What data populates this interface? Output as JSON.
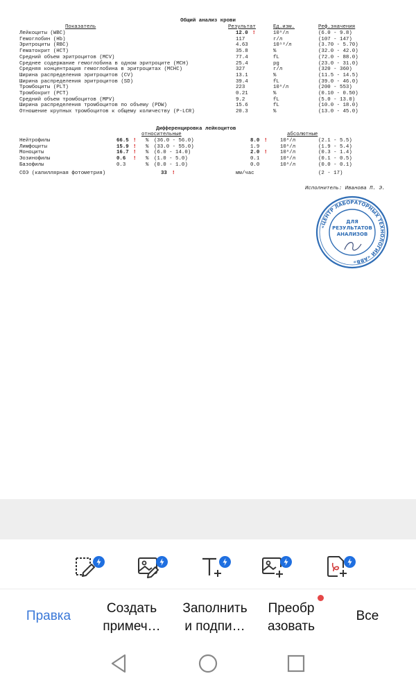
{
  "document": {
    "title": "Общий анализ крови",
    "headers": {
      "indicator": "Показатель",
      "result": "Результат",
      "unit": "Ед.изм.",
      "ref": "Реф.значения"
    },
    "rows": [
      {
        "name": "Лейкоциты (WBC)",
        "value": "12.0",
        "flag": "!",
        "unit": "10⁹/л",
        "ref": "(6.0 - 9.8)"
      },
      {
        "name": "Гемоглобин (Hb)",
        "value": "117",
        "flag": "",
        "unit": "г/л",
        "ref": "(107 - 147)"
      },
      {
        "name": "Эритроциты (RBC)",
        "value": "4.63",
        "flag": "",
        "unit": "10¹²/л",
        "ref": "(3.70 - 5.70)"
      },
      {
        "name": "Гематокрит (HCT)",
        "value": "35.8",
        "flag": "",
        "unit": "%",
        "ref": "(32.0 - 42.0)"
      },
      {
        "name": "Средний объем эритроцитов (MCV)",
        "value": "77.4",
        "flag": "",
        "unit": "fL",
        "ref": "(72.0 - 88.0)"
      },
      {
        "name": "Среднее содержание гемоглобина в одном эритроците (MCH)",
        "value": "25.4",
        "flag": "",
        "unit": "pg",
        "ref": "(23.0 - 31.0)"
      },
      {
        "name": "Средняя концентрация гемоглобина в эритроцитах (MCHC)",
        "value": "327",
        "flag": "",
        "unit": "г/л",
        "ref": "(320 - 360)"
      },
      {
        "name": "Ширина распределения эритроцитов (CV)",
        "value": "13.1",
        "flag": "",
        "unit": "%",
        "ref": "(11.5 - 14.5)"
      },
      {
        "name": "Ширина распределения эритроцитов (SD)",
        "value": "39.4",
        "flag": "",
        "unit": "fL",
        "ref": "(39.0 - 46.0)"
      },
      {
        "name": "Тромбоциты (PLT)",
        "value": "223",
        "flag": "",
        "unit": "10⁹/л",
        "ref": "(200 - 553)"
      },
      {
        "name": "Тромбокрит (PCT)",
        "value": "0.21",
        "flag": "",
        "unit": "%",
        "ref": "(0.10 - 0.50)"
      },
      {
        "name": "Средний объем тромбоцитов (MPV)",
        "value": "9.2",
        "flag": "",
        "unit": "fL",
        "ref": "(5.0 - 13.0)"
      },
      {
        "name": "Ширина распределения тромбоцитов по объему (PDW)",
        "value": "15.6",
        "flag": "",
        "unit": "fL",
        "ref": "(10.0 - 18.0)"
      },
      {
        "name": "Отношение крупных тромбоцитов к общему количеству (P-LCR)",
        "value": "20.3",
        "flag": "",
        "unit": "%",
        "ref": "(13.0 - 45.0)"
      }
    ],
    "diff_title": "Дифференцировка лейкоцитов",
    "diff_rel_header": "относительные",
    "diff_abs_header": "абсолютные",
    "diff_rows": [
      {
        "name": "Нейтрофилы",
        "rel": "66.5",
        "rel_flag": "!",
        "rel_unit": "%",
        "rel_ref": "(36.0 - 56.0)",
        "abs": "8.0",
        "abs_flag": "!",
        "abs_unit": "10⁹/л",
        "abs_ref": "(2.1 - 5.5)"
      },
      {
        "name": "Лимфоциты",
        "rel": "15.9",
        "rel_flag": "!",
        "rel_unit": "%",
        "rel_ref": "(33.0 - 55.0)",
        "abs": "1.9",
        "abs_flag": "",
        "abs_unit": "10⁹/л",
        "abs_ref": "(1.9 - 5.4)"
      },
      {
        "name": "Моноциты",
        "rel": "16.7",
        "rel_flag": "!",
        "rel_unit": "%",
        "rel_ref": "(6.0 - 14.0)",
        "abs": "2.0",
        "abs_flag": "!",
        "abs_unit": "10⁹/л",
        "abs_ref": "(0.3 - 1.4)"
      },
      {
        "name": "Эозинофилы",
        "rel": "0.6",
        "rel_flag": "!",
        "rel_unit": "%",
        "rel_ref": "(1.0 - 5.0)",
        "abs": "0.1",
        "abs_flag": "",
        "abs_unit": "10⁹/л",
        "abs_ref": "(0.1 - 0.5)"
      },
      {
        "name": "Базофилы",
        "rel": "0.3",
        "rel_flag": "",
        "rel_unit": "%",
        "rel_ref": "(0.0 - 1.0)",
        "abs": "0.0",
        "abs_flag": "",
        "abs_unit": "10⁹/л",
        "abs_ref": "(0.0 - 0.1)"
      }
    ],
    "esr": {
      "name": "СОЭ (капиллярная фотометрия)",
      "value": "33",
      "flag": "!",
      "unit": "мм/час",
      "ref": "(2 - 17)"
    },
    "performer": "Исполнитель: Иванова П. Э.",
    "stamp": {
      "ring_text": "«ЦЕНТР ЛАБОРАТОРНЫХ ТЕХНОЛОГИЙ «АВВ»",
      "inner_text": "ДЛЯ РЕЗУЛЬТАТОВ АНАЛИЗОВ",
      "color": "#2f6db5"
    }
  },
  "toolbar": {
    "tools": [
      {
        "icon": "crop-edit-icon"
      },
      {
        "icon": "image-edit-icon"
      },
      {
        "icon": "text-add-icon"
      },
      {
        "icon": "image-add-icon"
      },
      {
        "icon": "pdf-add-icon"
      }
    ],
    "badge_color": "#1f6fe0"
  },
  "tabs": {
    "edit": "Правка",
    "annotate_1": "Создать",
    "annotate_2": "примеч…",
    "fill_1": "Заполнить",
    "fill_2": "и подпи…",
    "convert_1": "Преобр",
    "convert_2": "азовать",
    "all": "Все",
    "active_color": "#3a78d8",
    "dot_color": "#e54747"
  },
  "navbar": {
    "back": "back-triangle-icon",
    "home": "home-circle-icon",
    "recents": "recents-square-icon"
  }
}
